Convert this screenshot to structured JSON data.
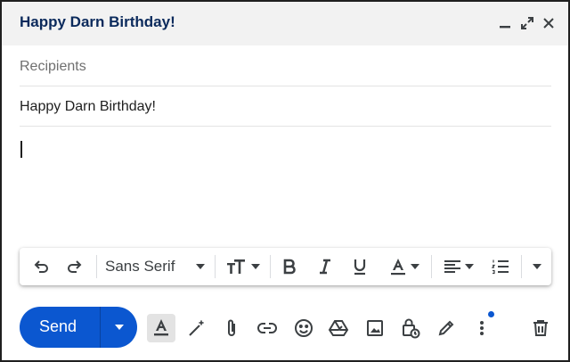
{
  "window": {
    "title": "Happy Darn Birthday!"
  },
  "compose": {
    "recipients_placeholder": "Recipients",
    "subject": "Happy Darn Birthday!"
  },
  "format_toolbar": {
    "font": "Sans Serif"
  },
  "actions": {
    "send_label": "Send"
  },
  "colors": {
    "accent": "#0b57d0",
    "title_text": "#0b2a5c",
    "header_bg": "#f2f2f2",
    "notification_dot": "#0b57d0"
  },
  "icons": [
    "minimize-icon",
    "expand-icon",
    "close-icon",
    "undo-icon",
    "redo-icon",
    "chevron-down-icon",
    "text-size-icon",
    "bold-icon",
    "italic-icon",
    "underline-icon",
    "text-color-icon",
    "align-icon",
    "numbered-list-icon",
    "more-formatting-icon",
    "formatting-options-icon",
    "help-me-write-icon",
    "attach-icon",
    "link-icon",
    "emoji-icon",
    "drive-icon",
    "photo-icon",
    "confidential-icon",
    "signature-icon",
    "more-options-icon",
    "trash-icon"
  ]
}
